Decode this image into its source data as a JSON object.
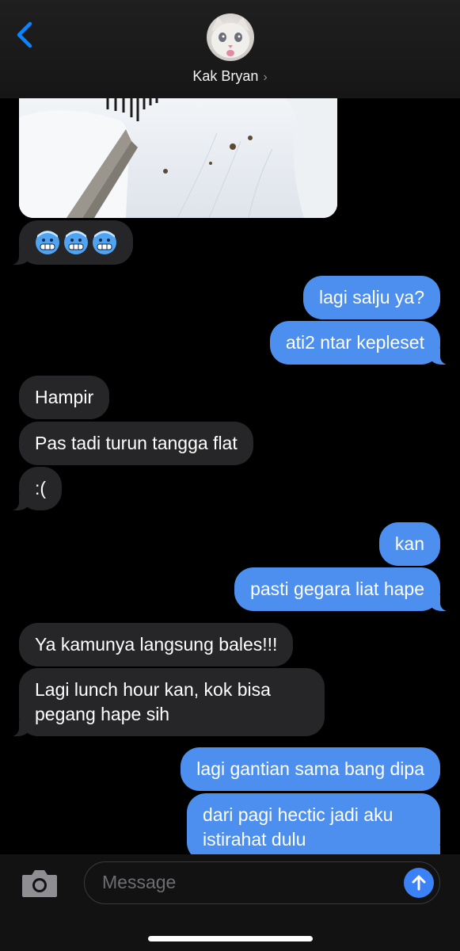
{
  "header": {
    "contact_name": "Kak Bryan",
    "chevron": "›",
    "back_icon": "chevron-left-icon",
    "accent_color": "#0a84ff"
  },
  "thread": {
    "image": "snow-photo",
    "emoji": [
      "cold-face-emoji",
      "cold-face-emoji",
      "cold-face-emoji"
    ],
    "messages": [
      {
        "from": "me",
        "text": "lagi salju ya?"
      },
      {
        "from": "me",
        "text": "ati2 ntar kepleset"
      },
      {
        "from": "them",
        "text": "Hampir"
      },
      {
        "from": "them",
        "text": "Pas tadi turun tangga flat"
      },
      {
        "from": "them",
        "text": ":("
      },
      {
        "from": "me",
        "text": "kan"
      },
      {
        "from": "me",
        "text": "pasti gegara liat hape"
      },
      {
        "from": "them",
        "text": "Ya kamunya langsung bales!!!"
      },
      {
        "from": "them",
        "text": "Lagi lunch hour kan, kok bisa pegang hape sih"
      },
      {
        "from": "me",
        "text": "lagi gantian sama bang dipa"
      },
      {
        "from": "me",
        "text": "dari pagi hectic jadi aku istirahat dulu"
      }
    ],
    "colors": {
      "incoming": "#262628",
      "outgoing": "#4d8fee"
    }
  },
  "composer": {
    "placeholder": "Message",
    "camera_icon": "camera-icon",
    "send_icon": "arrow-up-icon"
  }
}
